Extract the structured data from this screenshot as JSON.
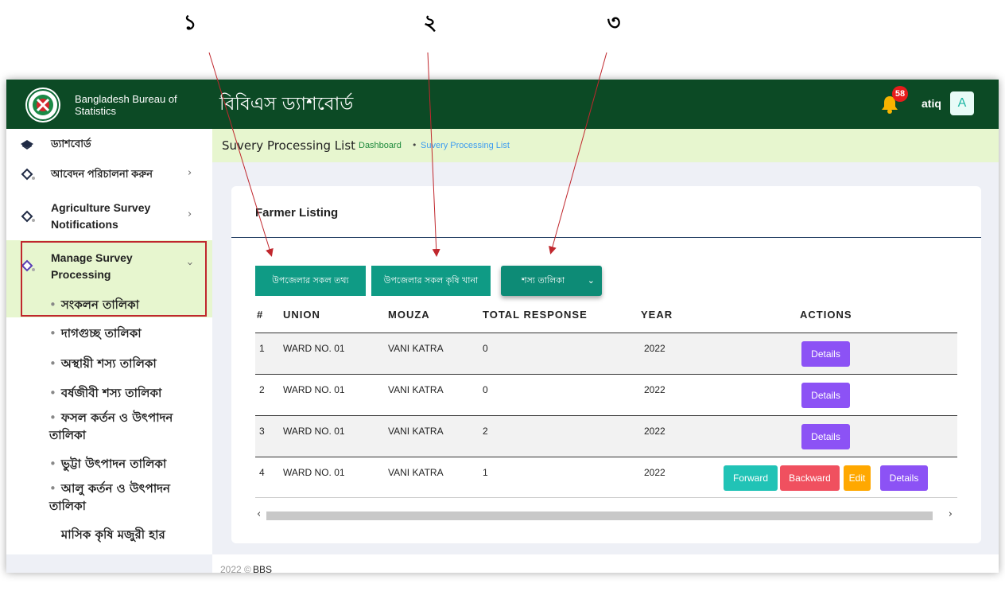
{
  "callouts": [
    "১",
    "২",
    "৩"
  ],
  "header": {
    "org_name": "Bangladesh Bureau of Statistics",
    "dashboard_title": "বিবিএস ড্যাশবোর্ড",
    "notification_count": "58",
    "user_name": "atiq",
    "user_initial": "A",
    "colors": {
      "topbar": "#0c4a25",
      "badge": "#e81c1c",
      "bell": "#f8b400"
    }
  },
  "sidebar": {
    "items": [
      {
        "label": "ড্যাশবোর্ড",
        "icon": "dashboard-icon"
      },
      {
        "label": "আবেদন পরিচালনা করুন",
        "icon": "drop-icon",
        "has_chevron": true
      },
      {
        "label": "Agriculture Survey Notifications",
        "icon": "drop-icon",
        "has_chevron": true
      },
      {
        "label": "Manage Survey Processing",
        "icon": "drop-icon",
        "expanded": true
      }
    ],
    "subitems": [
      "সংকলন তালিকা",
      "দাগগুচ্ছ তালিকা",
      "অস্থায়ী শস্য তালিকা",
      "বর্ষজীবী শস্য তালিকা",
      "ফসল কর্তন ও উৎপাদন তালিকা",
      "ভুট্টা উৎপাদন তালিকা",
      "আলু কর্তন ও উৎপাদন তালিকা",
      "মাসিক কৃষি মজুরী হার"
    ],
    "active_subitem": 0,
    "colors": {
      "active_bg": "#e7f6cf",
      "highlight_border": "#c0272d"
    }
  },
  "breadcrumb": {
    "page_title": "Suvery Processing List",
    "home": "Dashboard",
    "separator": "•",
    "current": "Suvery Processing List"
  },
  "card": {
    "title": "Farmer Listing",
    "tabs": [
      "উপজেলার সকল তথ্য",
      "উপজেলার সকল কৃষি খানা",
      "শস্য তালিকা"
    ],
    "table": {
      "headers": [
        "#",
        "UNION",
        "MOUZA",
        "TOTAL RESPONSE",
        "YEAR",
        "ACTIONS"
      ],
      "rows": [
        {
          "num": "1",
          "union": "WARD NO. 01",
          "mouza": "VANI KATRA",
          "total": "0",
          "year": "2022",
          "actions": [
            "Details"
          ]
        },
        {
          "num": "2",
          "union": "WARD NO. 01",
          "mouza": "VANI KATRA",
          "total": "0",
          "year": "2022",
          "actions": [
            "Details"
          ]
        },
        {
          "num": "3",
          "union": "WARD NO. 01",
          "mouza": "VANI KATRA",
          "total": "2",
          "year": "2022",
          "actions": [
            "Details"
          ]
        },
        {
          "num": "4",
          "union": "WARD NO. 01",
          "mouza": "VANI KATRA",
          "total": "1",
          "year": "2022",
          "actions": [
            "Forward",
            "Backward",
            "Edit",
            "Details"
          ]
        }
      ]
    },
    "action_colors": {
      "Forward": "#21c3b6",
      "Backward": "#f0505f",
      "Edit": "#ffa800",
      "Details": "#8c52f5"
    }
  },
  "footer": {
    "year": "2022 ©",
    "org": "BBS"
  }
}
